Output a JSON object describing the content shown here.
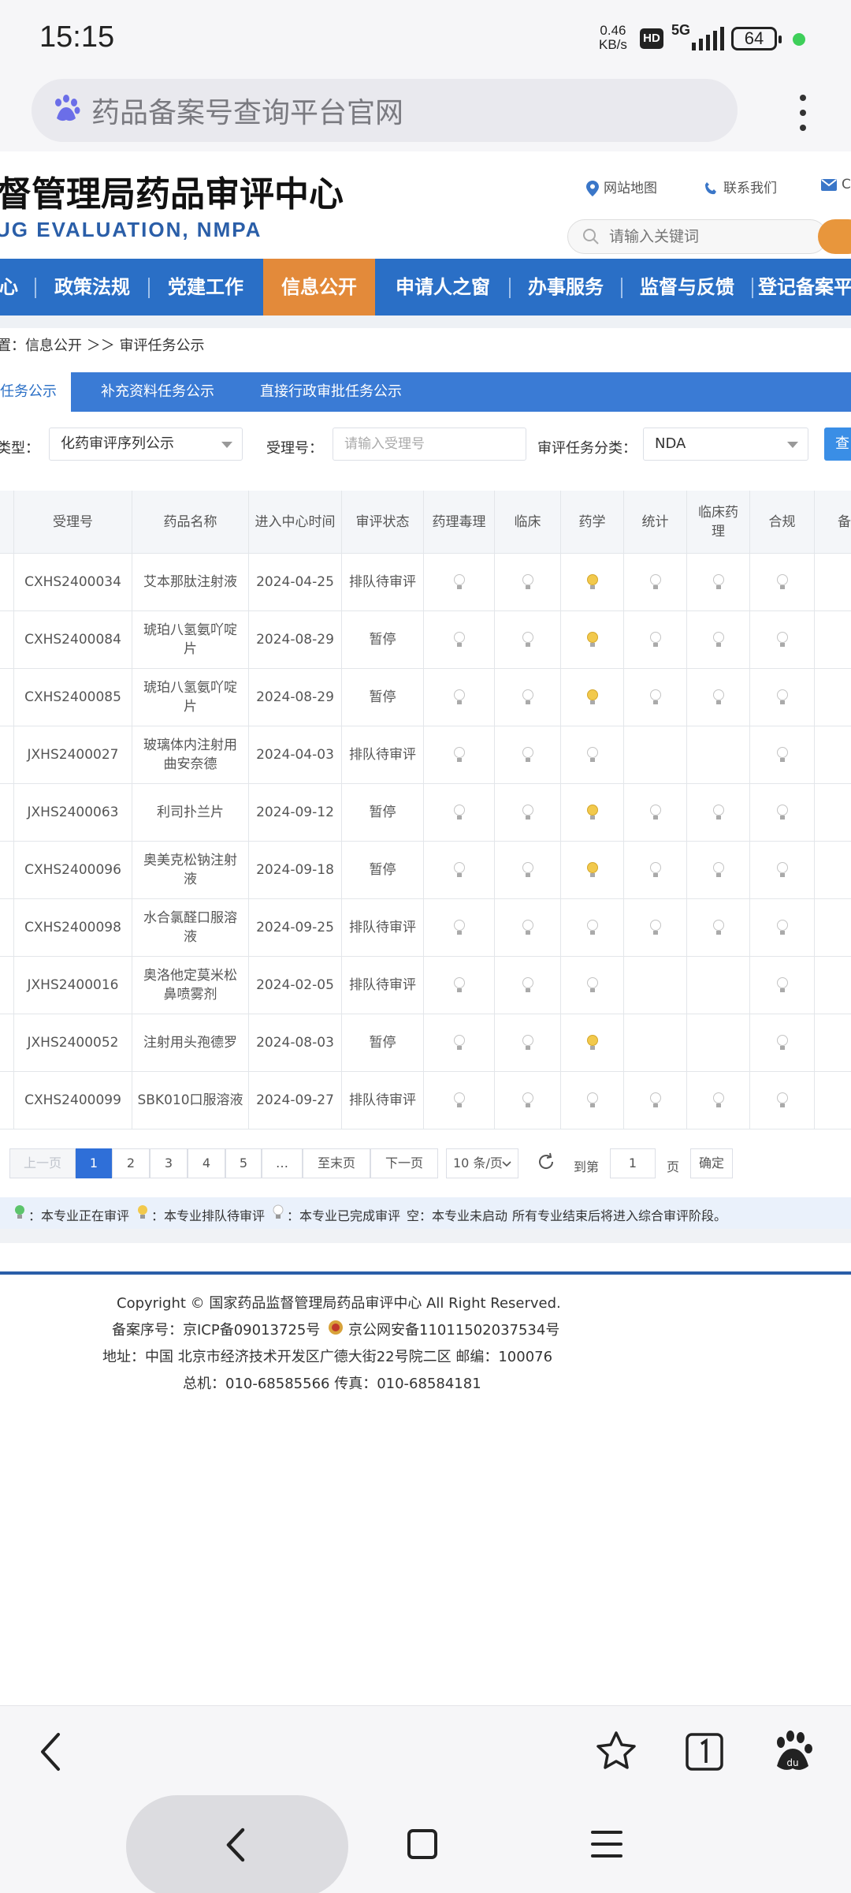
{
  "status": {
    "time": "15:15",
    "speed_value": "0.46",
    "speed_unit": "KB/s",
    "hd": "HD",
    "network": "5G",
    "battery": "64"
  },
  "browser": {
    "address_text": "药品备案号查询平台官网"
  },
  "site": {
    "title": "督管理局药品审评中心",
    "subtitle": "UG EVALUATION, NMPA",
    "links": {
      "sitemap": "网站地图",
      "contact": "联系我们",
      "c": "C"
    },
    "search_placeholder": "请输入关键词"
  },
  "nav": {
    "items": [
      "心",
      "政策法规",
      "党建工作",
      "信息公开",
      "申请人之窗",
      "办事服务",
      "监督与反馈",
      "登记备案平"
    ],
    "active": "信息公开"
  },
  "breadcrumb": "置：信息公开 ＞＞ 审评任务公示",
  "tabs": [
    "任务公示",
    "补充资料任务公示",
    "直接行政审批任务公示"
  ],
  "filters": {
    "type_label": "类型：",
    "type_value": "化药审评序列公示",
    "accept_label": "受理号：",
    "accept_placeholder": "请输入受理号",
    "category_label": "审评任务分类：",
    "category_value": "NDA",
    "query_label": "查"
  },
  "table": {
    "headers": [
      "受理号",
      "药品名称",
      "进入中心时间",
      "审评状态",
      "药理毒理",
      "临床",
      "药学",
      "统计",
      "临床药理",
      "合规",
      "备"
    ],
    "rows": [
      {
        "no": "CXHS2400034",
        "name": "艾本那肽注射液",
        "date": "2024-04-25",
        "status": "排队待审评",
        "flags": [
          "w",
          "w",
          "y",
          "w",
          "w",
          "w"
        ]
      },
      {
        "no": "CXHS2400084",
        "name": "琥珀八氢氨吖啶片",
        "date": "2024-08-29",
        "status": "暂停",
        "flags": [
          "w",
          "w",
          "y",
          "w",
          "w",
          "w"
        ]
      },
      {
        "no": "CXHS2400085",
        "name": "琥珀八氢氨吖啶片",
        "date": "2024-08-29",
        "status": "暂停",
        "flags": [
          "w",
          "w",
          "y",
          "w",
          "w",
          "w"
        ]
      },
      {
        "no": "JXHS2400027",
        "name": "玻璃体内注射用曲安奈德",
        "date": "2024-04-03",
        "status": "排队待审评",
        "flags": [
          "w",
          "w",
          "w",
          "",
          "",
          "w"
        ]
      },
      {
        "no": "JXHS2400063",
        "name": "利司扑兰片",
        "date": "2024-09-12",
        "status": "暂停",
        "flags": [
          "w",
          "w",
          "y",
          "w",
          "w",
          "w"
        ]
      },
      {
        "no": "CXHS2400096",
        "name": "奥美克松钠注射液",
        "date": "2024-09-18",
        "status": "暂停",
        "flags": [
          "w",
          "w",
          "y",
          "w",
          "w",
          "w"
        ]
      },
      {
        "no": "CXHS2400098",
        "name": "水合氯醛口服溶液",
        "date": "2024-09-25",
        "status": "排队待审评",
        "flags": [
          "w",
          "w",
          "w",
          "w",
          "w",
          "w"
        ]
      },
      {
        "no": "JXHS2400016",
        "name": "奥洛他定莫米松鼻喷雾剂",
        "date": "2024-02-05",
        "status": "排队待审评",
        "flags": [
          "w",
          "w",
          "w",
          "",
          "",
          "w"
        ]
      },
      {
        "no": "JXHS2400052",
        "name": "注射用头孢德罗",
        "date": "2024-08-03",
        "status": "暂停",
        "flags": [
          "w",
          "w",
          "y",
          "",
          "",
          "w"
        ]
      },
      {
        "no": "CXHS2400099",
        "name": "SBK010口服溶液",
        "date": "2024-09-27",
        "status": "排队待审评",
        "flags": [
          "w",
          "w",
          "w",
          "w",
          "w",
          "w"
        ]
      }
    ]
  },
  "pager": {
    "prev": "上一页",
    "pages": [
      "1",
      "2",
      "3",
      "4",
      "5",
      "…"
    ],
    "last": "至末页",
    "next": "下一页",
    "page_size": "10 条/页",
    "goto_label": "到第",
    "goto_value": "1",
    "page_suffix": "页",
    "confirm": "确定"
  },
  "legend": {
    "active": "：本专业正在审评",
    "queued": "：本专业排队待审评",
    "done": "：本专业已完成审评",
    "empty": "空：本专业未启动",
    "note": "所有专业结束后将进入综合审评阶段。"
  },
  "footer": {
    "copyright": "Copyright © 国家药品监督管理局药品审评中心   All Right Reserved.",
    "icp": "备案序号：京ICP备09013725号",
    "police": "京公网安备11011502037534号",
    "address": "地址：中国 北京市经济技术开发区广德大街22号院二区      邮编：100076",
    "phone": "总机：010-68585566      传真：010-68584181"
  },
  "colors": {
    "nav_blue": "#2a6fc6",
    "nav_active": "#e38a3a",
    "bulb_yellow": "#f2c94c",
    "bulb_green": "#5cc46b"
  }
}
